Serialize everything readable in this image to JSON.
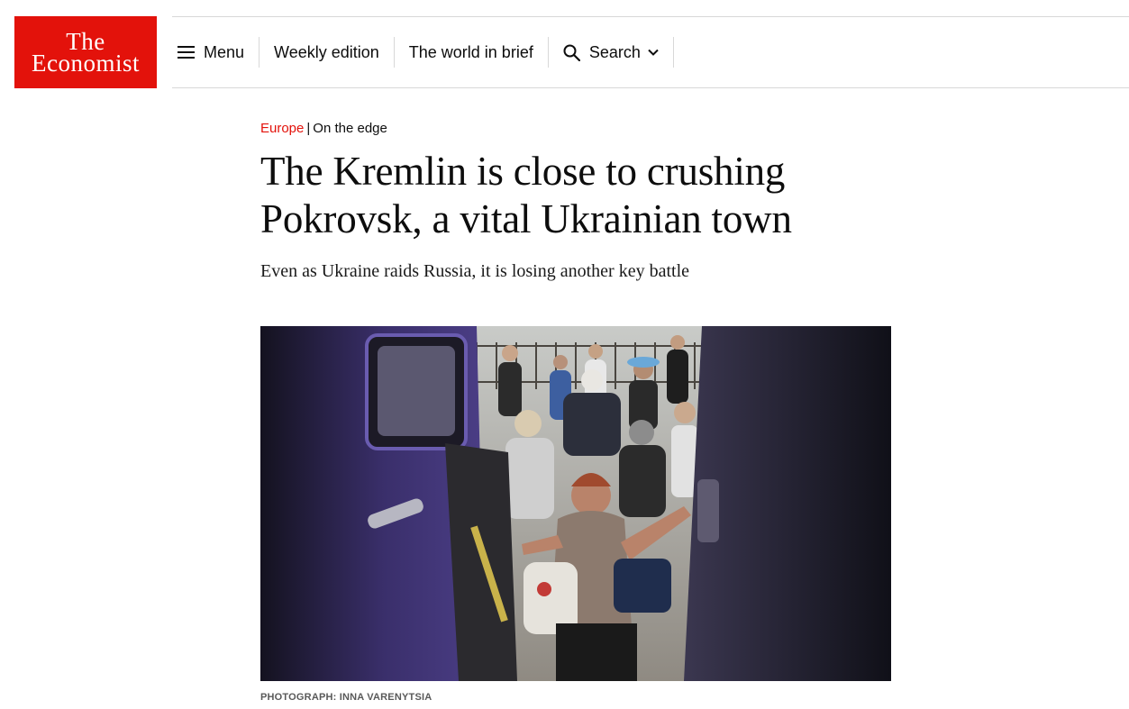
{
  "logo": {
    "line1": "The",
    "line2": "Economist"
  },
  "nav": {
    "menu_label": "Menu",
    "weekly_label": "Weekly edition",
    "brief_label": "The world in brief",
    "search_label": "Search"
  },
  "article": {
    "section": "Europe",
    "separator": "|",
    "fly_title": "On the edge",
    "headline": "The Kremlin is close to crushing Pokrovsk, a vital Ukrainian town",
    "standfirst": "Even as Ukraine raids Russia, it is losing another key battle",
    "photo_caption": "PHOTOGRAPH: INNA VARENYTSIA"
  },
  "colors": {
    "brand_red": "#e3120b",
    "divider": "#d8d8d8",
    "text": "#0d0d0d",
    "caption": "#595959"
  }
}
